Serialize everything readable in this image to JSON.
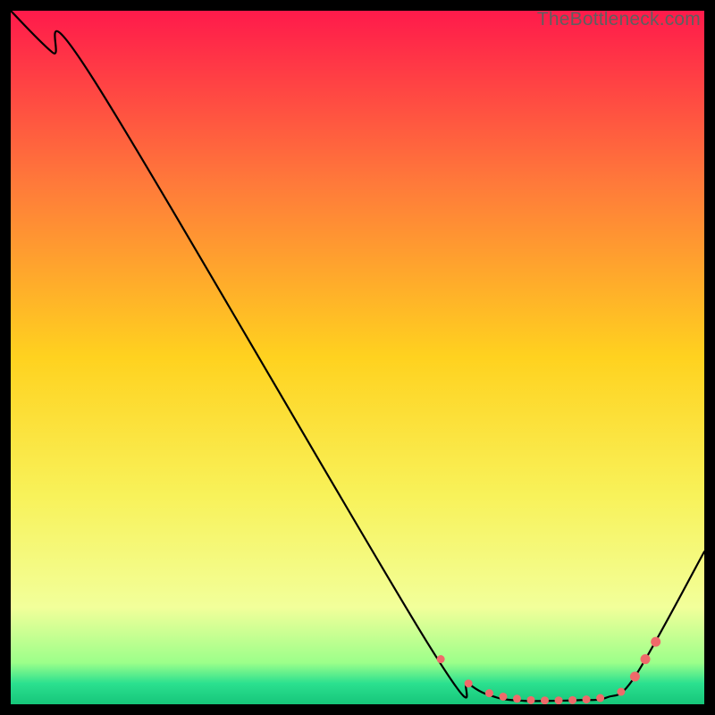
{
  "watermark": "TheBottleneck.com",
  "chart_data": {
    "type": "line",
    "title": "",
    "xlabel": "",
    "ylabel": "",
    "xlim": [
      0,
      100
    ],
    "ylim": [
      0,
      100
    ],
    "grid": false,
    "legend": false,
    "background_gradient": {
      "stops": [
        {
          "offset": 0.0,
          "color": "#ff1a4b"
        },
        {
          "offset": 0.25,
          "color": "#ff7a3a"
        },
        {
          "offset": 0.5,
          "color": "#ffd21f"
        },
        {
          "offset": 0.7,
          "color": "#f8f25a"
        },
        {
          "offset": 0.86,
          "color": "#f2ff9a"
        },
        {
          "offset": 0.94,
          "color": "#9cff8a"
        },
        {
          "offset": 0.97,
          "color": "#2be08f"
        },
        {
          "offset": 1.0,
          "color": "#16c67a"
        }
      ]
    },
    "series": [
      {
        "name": "bottleneck-curve",
        "x": [
          0,
          6,
          12,
          60,
          66,
          70,
          74,
          78,
          82,
          86,
          90,
          100
        ],
        "y": [
          100,
          94,
          90,
          9,
          3,
          1,
          0.5,
          0.5,
          0.6,
          1,
          4,
          22
        ]
      }
    ],
    "markers": {
      "name": "highlight-points",
      "color": "#ef6a6a",
      "x": [
        62,
        66,
        69,
        71,
        73,
        75,
        77,
        79,
        81,
        83,
        85,
        88,
        90,
        91.5,
        93
      ],
      "y": [
        6.5,
        3,
        1.6,
        1.1,
        0.8,
        0.6,
        0.55,
        0.55,
        0.6,
        0.7,
        0.9,
        1.8,
        4,
        6.5,
        9
      ],
      "r": [
        4.5,
        4.5,
        4.5,
        4.5,
        4.5,
        4.5,
        4.5,
        4.5,
        4.5,
        4.5,
        4.5,
        4.5,
        5.5,
        5.5,
        5.5
      ]
    }
  }
}
